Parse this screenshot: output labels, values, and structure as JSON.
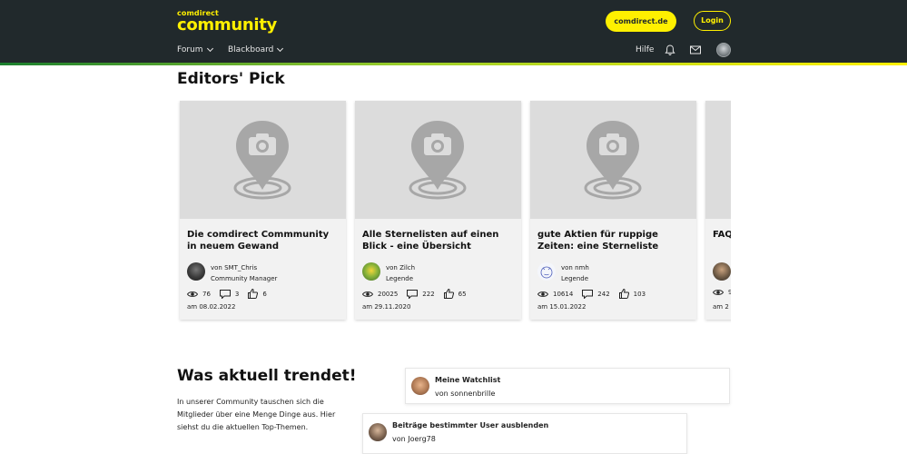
{
  "header": {
    "logo_small": "comdirect",
    "logo_big": "community",
    "cta_label": "comdirect.de",
    "login_label": "Login",
    "nav": [
      {
        "label": "Forum"
      },
      {
        "label": "Blackboard"
      }
    ],
    "help_label": "Hilfe",
    "colors": {
      "background": "#21292c",
      "accent": "#fff000"
    }
  },
  "editors_pick": {
    "title": "Editors' Pick",
    "cards": [
      {
        "title": "Die comdirect Commmunity in neuem Gewand",
        "author": "von SMT_Chris",
        "role": "Community Manager",
        "views": "76",
        "comments": "3",
        "likes": "6",
        "date": "am 08.02.2022"
      },
      {
        "title": "Alle Sternelisten auf einen Blick - eine Übersicht",
        "author": "von Zilch",
        "role": "Legende",
        "views": "20025",
        "comments": "222",
        "likes": "65",
        "date": "am 29.11.2020"
      },
      {
        "title": "gute Aktien für ruppige Zeiten: eine Sterneliste",
        "author": "von nmh",
        "role": "Legende",
        "views": "10614",
        "comments": "242",
        "likes": "103",
        "date": "am 15.01.2022"
      },
      {
        "title": "FAQ",
        "author": "",
        "role": "",
        "views": "9",
        "comments": "",
        "likes": "",
        "date": "am 2"
      }
    ]
  },
  "trending": {
    "title": "Was aktuell trendet!",
    "text": "In unserer Community tauschen sich die Mitglieder über eine Menge Dinge aus. Hier siehst du die aktuellen Top-Themen.",
    "topics": [
      {
        "title": "Meine Watchlist",
        "author": "von sonnenbrille"
      },
      {
        "title": "Beiträge bestimmter User ausblenden",
        "author": "von Joerg78"
      }
    ]
  },
  "icons": [
    "chevron-down-icon",
    "bell-icon",
    "mail-icon",
    "user-avatar",
    "camera-pin-placeholder-icon",
    "eye-icon",
    "comment-icon",
    "thumbs-up-icon"
  ]
}
